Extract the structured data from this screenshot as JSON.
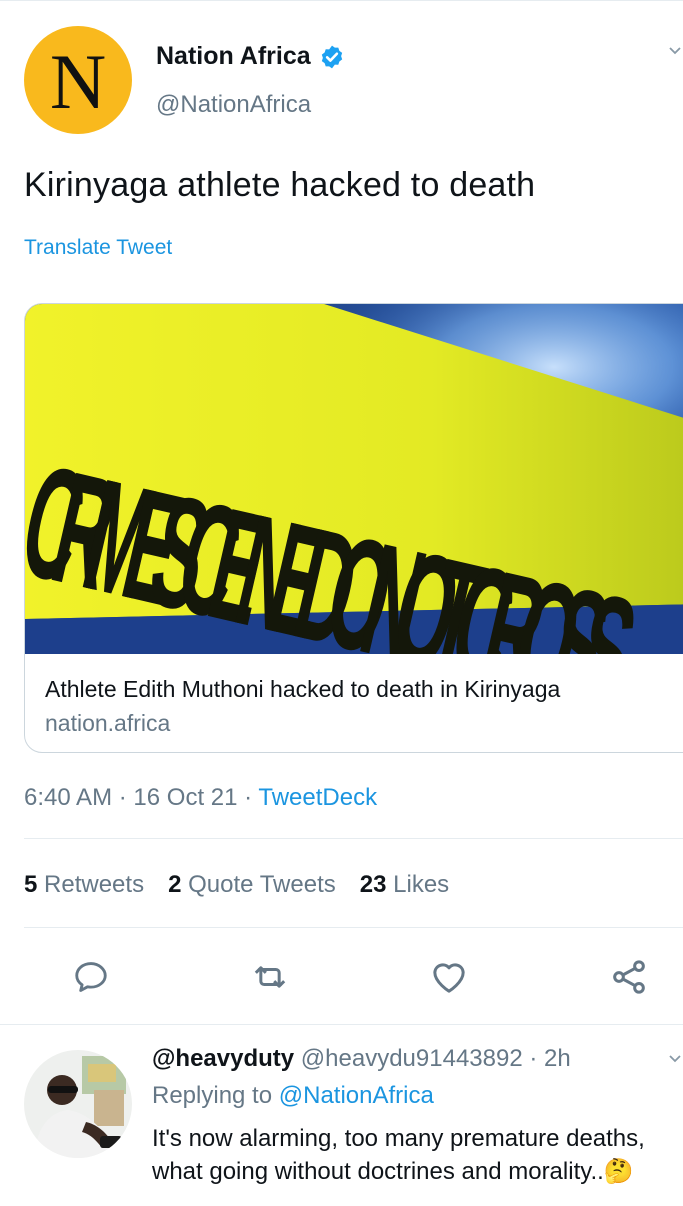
{
  "tweet": {
    "avatar_letter": "N",
    "display_name": "Nation Africa",
    "handle": "@NationAfrica",
    "verified": true,
    "text": "Kirinyaga athlete hacked to death",
    "translate_label": "Translate Tweet",
    "card": {
      "image_text": "CRIME SCENE DO NOT CROSS",
      "title": "Athlete Edith Muthoni hacked to death in Kirinyaga",
      "domain": "nation.africa"
    },
    "time": "6:40 AM",
    "date": "16 Oct 21",
    "source": "TweetDeck",
    "separator": "·"
  },
  "stats": {
    "retweets_count": "5",
    "retweets_label": "Retweets",
    "quotes_count": "2",
    "quotes_label": "Quote Tweets",
    "likes_count": "23",
    "likes_label": "Likes"
  },
  "actions": [
    "reply-icon",
    "retweet-icon",
    "like-icon",
    "share-icon"
  ],
  "reply": {
    "display_name": "@heavyduty",
    "handle": "@heavydu91443892",
    "time": "2h",
    "replying_prefix": "Replying to",
    "replying_to": "@NationAfrica",
    "text": "It's now alarming, too many premature deaths, what going without doctrines and morality..",
    "emoji": "🤔"
  },
  "colors": {
    "accent": "#1b95e0",
    "secondary_text": "#657786",
    "avatar_bg": "#f9b91d",
    "verified": "#1da1f2"
  }
}
